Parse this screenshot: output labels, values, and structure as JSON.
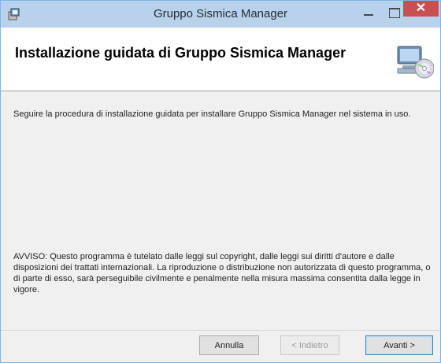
{
  "window": {
    "title": "Gruppo Sismica Manager",
    "close_symbol": "✕"
  },
  "header": {
    "title": "Installazione guidata di Gruppo Sismica Manager",
    "icon": "computer-cd-icon"
  },
  "content": {
    "intro": "Seguire la procedura di installazione guidata per installare Gruppo Sismica Manager nel sistema in uso.",
    "warning": "AVVISO: Questo programma è tutelato dalle leggi sul copyright, dalle leggi sui diritti d'autore e dalle disposizioni dei trattati internazionali. La riproduzione o distribuzione non autorizzata di questo programma, o di parte di esso, sarà perseguibile civilmente e penalmente nella misura massima consentita dalla legge in vigore."
  },
  "buttons": {
    "cancel": "Annulla",
    "back": "< Indietro",
    "next": "Avanti >"
  },
  "colors": {
    "titlebar": "#b9d1ea",
    "close": "#c75050",
    "body": "#f0f0f0"
  }
}
